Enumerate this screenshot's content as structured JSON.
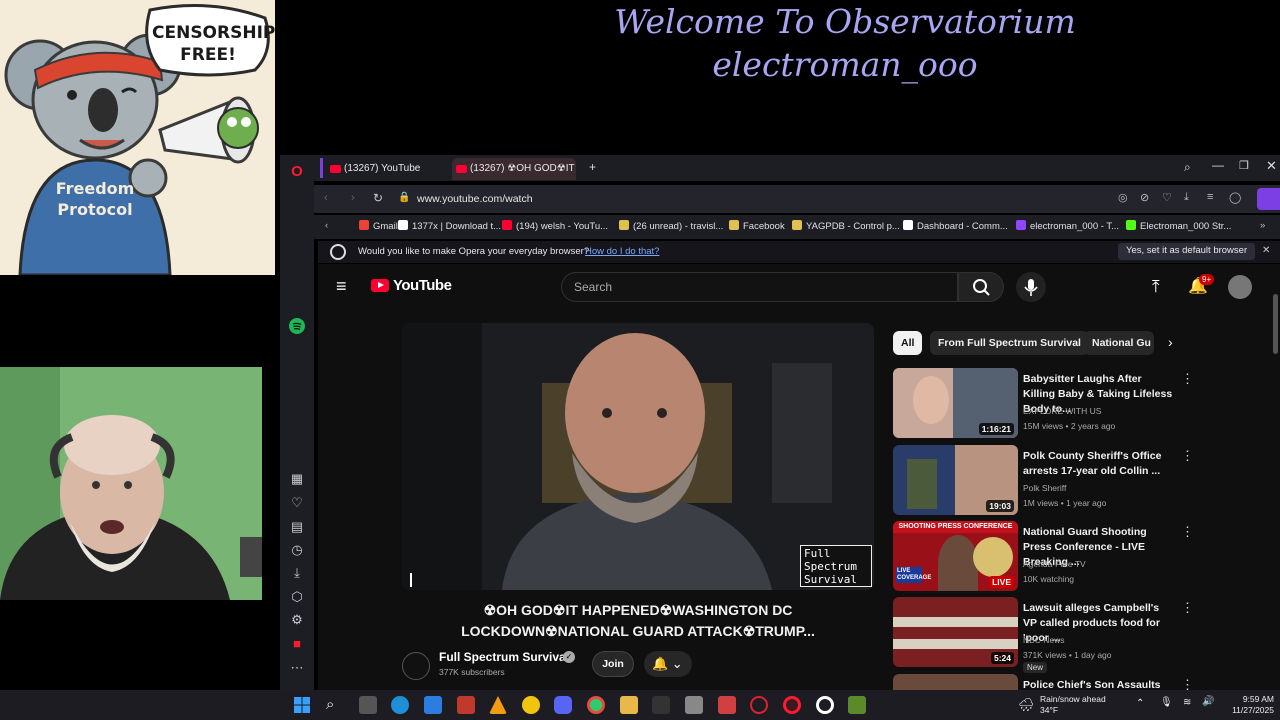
{
  "overlay": {
    "sticker_caption": "CENSORSHIP FREE!",
    "sticker_shirt": "Freedom Protocol",
    "welcome_line1": "Welcome To Observatorium",
    "welcome_line2": "electroman_ooo"
  },
  "browser": {
    "tabs": [
      {
        "label": "(13267) YouTube"
      },
      {
        "label": "(13267) ☢OH GOD☢IT"
      }
    ],
    "url": "www.youtube.com/watch",
    "bookmarks": [
      {
        "label": "Gmail",
        "color": "#ea4335"
      },
      {
        "label": "1377x | Download t...",
        "color": "#ffffff"
      },
      {
        "label": "(194) welsh - YouTu...",
        "color": "#ff0033"
      },
      {
        "label": "(26 unread) - travisl...",
        "color": "#e0c050"
      },
      {
        "label": "Facebook",
        "color": "#e0c050"
      },
      {
        "label": "YAGPDB - Control p...",
        "color": "#e0c050"
      },
      {
        "label": "Dashboard - Comm...",
        "color": "#ffffff"
      },
      {
        "label": "electroman_000 - T...",
        "color": "#9146ff"
      },
      {
        "label": "Electroman_000 Str...",
        "color": "#53fc18"
      }
    ],
    "notice_text": "Would you like to make Opera your everyday browser?",
    "notice_link": "How do I do that?",
    "notice_button": "Yes, set it as default browser"
  },
  "youtube": {
    "logo_text": "YouTube",
    "search_placeholder": "Search",
    "notification_badge": "9+",
    "video_overlay_logo": "Full Spectrum Survival",
    "video_title": "☢OH GOD☢IT HAPPENED☢WASHINGTON DC LOCKDOWN☢NATIONAL GUARD ATTACK☢TRUMP...",
    "channel_name": "Full Spectrum Survival",
    "subscribers": "377K subscribers",
    "join_label": "Join",
    "chips": [
      "All",
      "From Full Spectrum Survival",
      "National Gu"
    ],
    "recommendations": [
      {
        "title": "Babysitter Laughs After Killing Baby & Taking Lifeless Body to...",
        "channel": "EXPLORE WITH US",
        "meta": "15M views • 2 years ago",
        "duration": "1:16:21"
      },
      {
        "title": "Polk County Sheriff's Office arrests 17-year old Collin ...",
        "channel": "Polk Sheriff",
        "meta": "1M views • 1 year ago",
        "duration": "19:03"
      },
      {
        "title": "National Guard Shooting Press Conference - LIVE Breaking ...",
        "channel": "Agenda-Free TV",
        "meta": "10K watching",
        "duration": "LIVE",
        "thumb_banner": "SHOOTING PRESS CONFERENCE",
        "thumb_tag": "LIVE COVERAGE"
      },
      {
        "title": "Lawsuit alleges Campbell's VP called products food for 'poor ...",
        "channel": "NBC News",
        "meta": "371K views • 1 day ago",
        "duration": "5:24",
        "badge": "New"
      },
      {
        "title": "Police Chief's Son Assaults",
        "channel": "",
        "meta": "",
        "duration": ""
      }
    ]
  },
  "taskbar": {
    "weather_line1": "Rain/snow ahead",
    "weather_line2": "34°F",
    "time": "9:59 AM",
    "date": "11/27/2025"
  }
}
